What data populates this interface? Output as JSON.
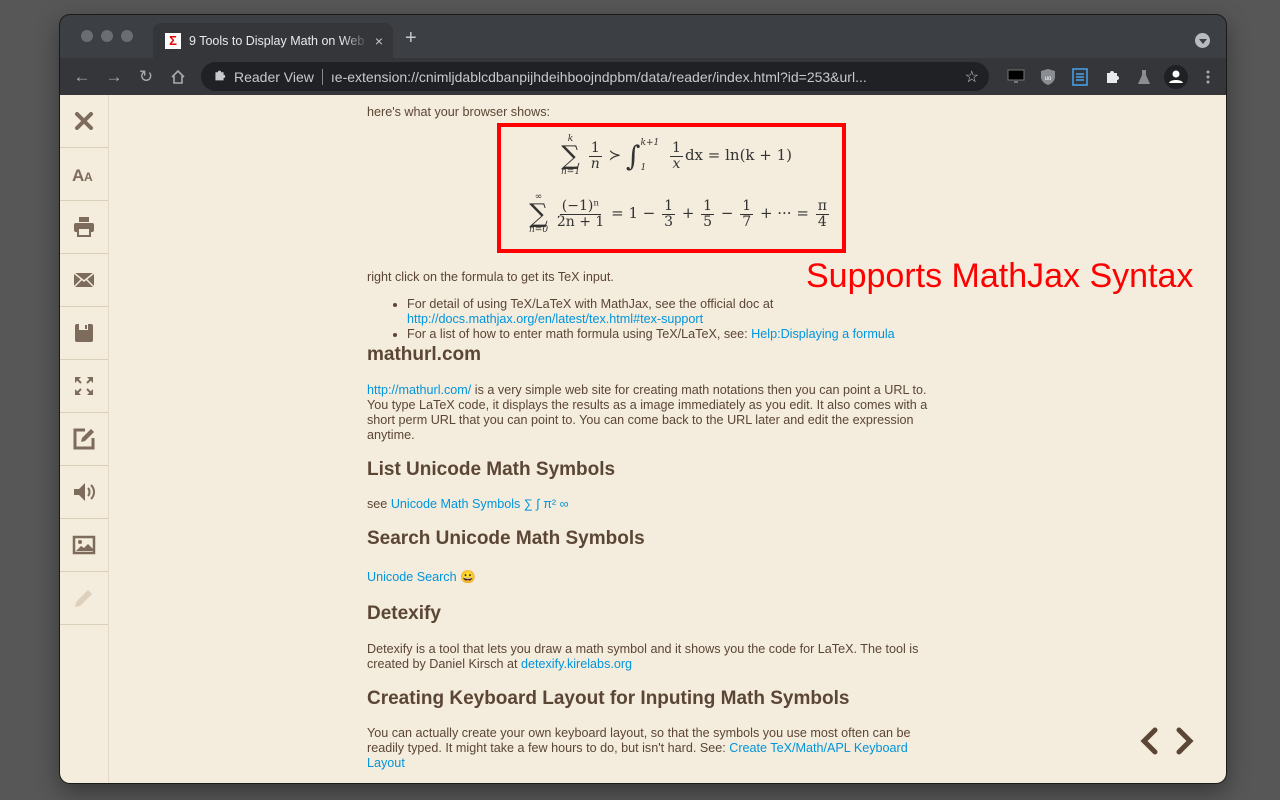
{
  "browser": {
    "tab": {
      "title": "9 Tools to Display Math on Web",
      "favicon": "sigma-icon",
      "close_label": "×"
    },
    "new_tab_label": "+",
    "omnibox": {
      "chip": "Reader View",
      "url": "ıe-extension://cnimljdablcdbanpijhdeihboojndpbm/data/reader/index.html?id=253&url..."
    },
    "toolbar_icons": [
      "back-icon",
      "forward-icon",
      "reload-icon",
      "home-icon",
      "star-icon"
    ],
    "extension_icons": [
      "monitor-icon",
      "ublock-shield-icon",
      "reader-view-icon",
      "puzzle-extensions-icon",
      "flask-icon",
      "profile-avatar-icon",
      "kebab-menu-icon"
    ]
  },
  "sidebar": {
    "items": [
      {
        "name": "close",
        "icon": "close-icon"
      },
      {
        "name": "font-size",
        "icon": "font-size-icon"
      },
      {
        "name": "print",
        "icon": "printer-icon"
      },
      {
        "name": "email",
        "icon": "envelope-icon"
      },
      {
        "name": "save",
        "icon": "floppy-disk-icon"
      },
      {
        "name": "fullscreen",
        "icon": "fullscreen-icon"
      },
      {
        "name": "design-mode",
        "icon": "edit-icon"
      },
      {
        "name": "speech",
        "icon": "speaker-icon"
      },
      {
        "name": "images",
        "icon": "image-icon"
      },
      {
        "name": "highlight",
        "icon": "pencil-icon"
      }
    ]
  },
  "article": {
    "intro": "here's what your browser shows:",
    "math": {
      "line1": {
        "sum_upper": "k",
        "sum_lower": "n=1",
        "frac_num": "1",
        "frac_den": "n",
        "relation": "≻",
        "int_upper": "k+1",
        "int_lower": "1",
        "int_frac_num": "1",
        "int_frac_den": "x",
        "tail": "dx = ln(k + 1)"
      },
      "line2": {
        "sum_upper": "∞",
        "sum_lower": "n=0",
        "frac_num": "(−1)ⁿ",
        "frac_den": "2n + 1",
        "eq": "= 1 −",
        "f1_num": "1",
        "f1_den": "3",
        "op1": "+",
        "f2_num": "1",
        "f2_den": "5",
        "op2": "−",
        "f3_num": "1",
        "f3_den": "7",
        "tail": "+ ··· =",
        "f4_num": "π",
        "f4_den": "4"
      }
    },
    "right_click_note": "right click on the formula to get its TeX input.",
    "bullets": [
      {
        "text": "For detail of using TeX/LaTeX with MathJax, see the official doc at ",
        "link": "http://docs.mathjax.org/en/latest/tex.html#tex-support"
      },
      {
        "text": "For a list of how to enter math formula using TeX/LaTeX, see: ",
        "link": "Help:Displaying a formula"
      }
    ],
    "sections": [
      {
        "heading": "mathurl.com",
        "link": "http://mathurl.com/",
        "text": " is a very simple web site for creating math notations then you can point a URL to. You type LaTeX code, it displays the results as a image immediately as you edit. It also comes with a short perm URL that you can point to. You can come back to the URL later and edit the expression anytime."
      },
      {
        "heading": "List Unicode Math Symbols",
        "prefix": "see ",
        "link": "Unicode Math Symbols ∑ ∫ π² ∞"
      },
      {
        "heading": "Search Unicode Math Symbols",
        "link": "Unicode Search",
        "emoji": "😀"
      },
      {
        "heading": "Detexify",
        "text": "Detexify is a tool that lets you draw a math symbol and it shows you the code for LaTeX. The tool is created by Daniel Kirsch at ",
        "link": "detexify.kirelabs.org"
      },
      {
        "heading": "Creating Keyboard Layout for Inputing Math Symbols",
        "text": "You can actually create your own keyboard layout, so that the symbols you use most often can be readily typed. It might take a few hours to do, but isn't hard. See: ",
        "link": "Create TeX/Math/APL Keyboard Layout"
      }
    ]
  },
  "annotation": {
    "text": "Supports MathJax Syntax",
    "color": "#ff0000"
  },
  "pager": {
    "prev": "previous-page-icon",
    "next": "next-page-icon"
  },
  "colors": {
    "page_bg": "#f4ecdc",
    "text": "#5b4636",
    "link": "#0095dd",
    "sidebar_icon": "#7d6b5c",
    "highlight_box": "#ff0000"
  }
}
